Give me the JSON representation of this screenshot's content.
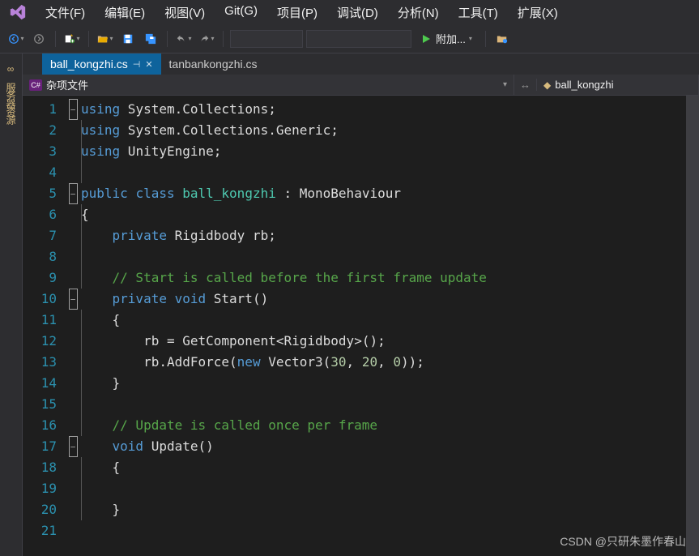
{
  "menu": [
    "文件(F)",
    "编辑(E)",
    "视图(V)",
    "Git(G)",
    "项目(P)",
    "调试(D)",
    "分析(N)",
    "工具(T)",
    "扩展(X)"
  ],
  "toolbar": {
    "attach_label": "附加..."
  },
  "sidetab": "服务器",
  "tabs": [
    {
      "label": "ball_kongzhi.cs",
      "active": true
    },
    {
      "label": "tanbankongzhi.cs",
      "active": false
    }
  ],
  "nav": {
    "left": "杂项文件",
    "right": "ball_kongzhi"
  },
  "code": {
    "line_count": 21,
    "lines": [
      [
        [
          "kw",
          "using"
        ],
        [
          "pln",
          " System"
        ],
        [
          "pun",
          "."
        ],
        [
          "pln",
          "Collections"
        ],
        [
          "pun",
          ";"
        ]
      ],
      [
        [
          "kw",
          "using"
        ],
        [
          "pln",
          " System"
        ],
        [
          "pun",
          "."
        ],
        [
          "pln",
          "Collections"
        ],
        [
          "pun",
          "."
        ],
        [
          "pln",
          "Generic"
        ],
        [
          "pun",
          ";"
        ]
      ],
      [
        [
          "kw",
          "using"
        ],
        [
          "pln",
          " UnityEngine"
        ],
        [
          "pun",
          ";"
        ]
      ],
      [],
      [
        [
          "kw",
          "public"
        ],
        [
          "pln",
          " "
        ],
        [
          "kw",
          "class"
        ],
        [
          "pln",
          " "
        ],
        [
          "cls",
          "ball_kongzhi"
        ],
        [
          "pln",
          " "
        ],
        [
          "pun",
          ":"
        ],
        [
          "pln",
          " MonoBehaviour"
        ]
      ],
      [
        [
          "pun",
          "{"
        ]
      ],
      [
        [
          "pln",
          "    "
        ],
        [
          "kw",
          "private"
        ],
        [
          "pln",
          " Rigidbody rb"
        ],
        [
          "pun",
          ";"
        ]
      ],
      [],
      [
        [
          "pln",
          "    "
        ],
        [
          "com",
          "// Start is called before the first frame update"
        ]
      ],
      [
        [
          "pln",
          "    "
        ],
        [
          "kw",
          "private"
        ],
        [
          "pln",
          " "
        ],
        [
          "kw",
          "void"
        ],
        [
          "pln",
          " Start"
        ],
        [
          "pun",
          "()"
        ]
      ],
      [
        [
          "pln",
          "    "
        ],
        [
          "pun",
          "{"
        ]
      ],
      [
        [
          "pln",
          "        rb "
        ],
        [
          "pun",
          "="
        ],
        [
          "pln",
          " GetComponent"
        ],
        [
          "pun",
          "<"
        ],
        [
          "pln",
          "Rigidbody"
        ],
        [
          "pun",
          ">();"
        ]
      ],
      [
        [
          "pln",
          "        rb"
        ],
        [
          "pun",
          "."
        ],
        [
          "pln",
          "AddForce"
        ],
        [
          "pun",
          "("
        ],
        [
          "kw",
          "new"
        ],
        [
          "pln",
          " Vector3"
        ],
        [
          "pun",
          "("
        ],
        [
          "num",
          "30"
        ],
        [
          "pun",
          ", "
        ],
        [
          "num",
          "20"
        ],
        [
          "pun",
          ", "
        ],
        [
          "num",
          "0"
        ],
        [
          "pun",
          "));"
        ]
      ],
      [
        [
          "pln",
          "    "
        ],
        [
          "pun",
          "}"
        ]
      ],
      [],
      [
        [
          "pln",
          "    "
        ],
        [
          "com",
          "// Update is called once per frame"
        ]
      ],
      [
        [
          "pln",
          "    "
        ],
        [
          "kw",
          "void"
        ],
        [
          "pln",
          " Update"
        ],
        [
          "pun",
          "()"
        ]
      ],
      [
        [
          "pln",
          "    "
        ],
        [
          "pun",
          "{"
        ]
      ],
      [],
      [
        [
          "pln",
          "    "
        ],
        [
          "pun",
          "}"
        ]
      ],
      []
    ],
    "fold": {
      "1": "box",
      "5": "box",
      "10": "box",
      "17": "box"
    }
  },
  "watermark": "CSDN @只研朱墨作春山"
}
